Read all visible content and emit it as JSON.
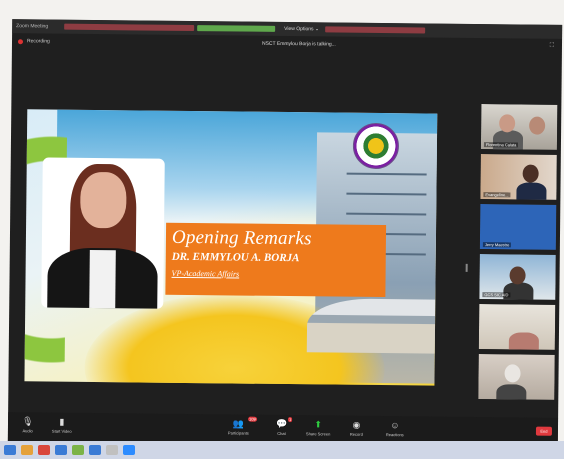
{
  "app": {
    "window_title": "Zoom Meeting",
    "view_options": "View Options ⌄"
  },
  "recording": {
    "label": "Recording",
    "talking": "NSCT Emmylou Borja is talking..."
  },
  "slide": {
    "title": "Opening Remarks",
    "name": "DR. EMMYLOU A. BORJA",
    "role": "VP-Academic Affairs"
  },
  "gallery": [
    {
      "name": "Florentina Calata"
    },
    {
      "name": "Evangeline..."
    },
    {
      "name": "Jerry Maestre"
    },
    {
      "name": "GCS SIC AID"
    },
    {
      "name": ""
    },
    {
      "name": ""
    }
  ],
  "controls": {
    "audio": "Audio",
    "video": "Start Video",
    "participants": "Participants",
    "participants_count": "109",
    "chat": "Chat",
    "share": "Share Screen",
    "record": "Record",
    "reactions": "Reactions",
    "end": "End",
    "chat_badge": "1"
  },
  "icons": [
    "mic-icon",
    "video-off-icon",
    "participants-icon",
    "chat-icon",
    "share-screen-icon",
    "record-icon",
    "reactions-icon"
  ],
  "colors": {
    "banner_orange": "#ee7a1c",
    "share_green": "#2ecc40",
    "end_red": "#e0393e"
  }
}
